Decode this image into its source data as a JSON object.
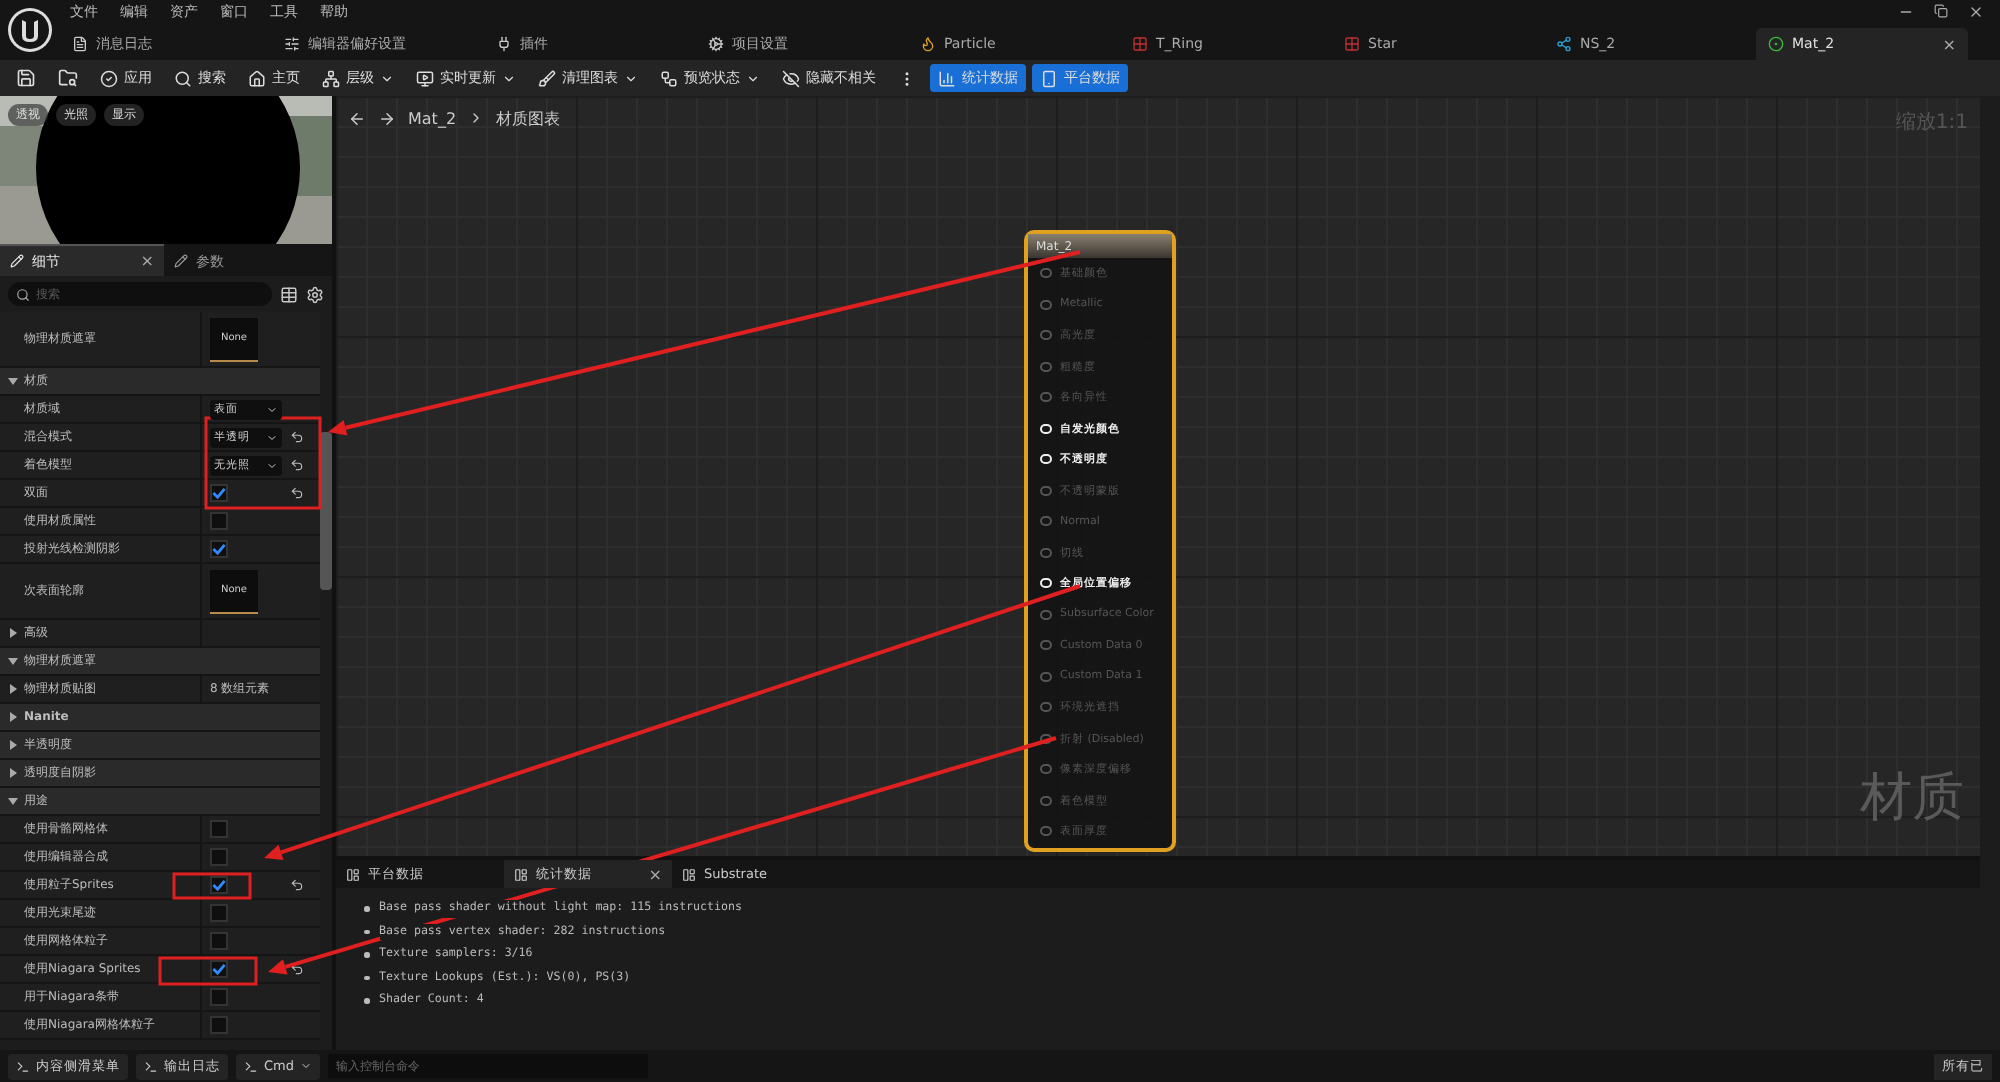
{
  "menu": [
    "文件",
    "编辑",
    "资产",
    "窗口",
    "工具",
    "帮助"
  ],
  "tabs": [
    {
      "label": "消息日志",
      "selected": false
    },
    {
      "label": "编辑器偏好设置",
      "selected": false
    },
    {
      "label": "插件",
      "selected": false
    },
    {
      "label": "项目设置",
      "selected": false
    },
    {
      "label": "Particle",
      "selected": false
    },
    {
      "label": "T_Ring",
      "selected": false
    },
    {
      "label": "Star",
      "selected": false
    },
    {
      "label": "NS_2",
      "selected": false
    },
    {
      "label": "Mat_2",
      "selected": true,
      "close": "×"
    }
  ],
  "toolbar": [
    {
      "kind": "icon"
    },
    {
      "kind": "icon"
    },
    {
      "label": "应用",
      "dropdown": false,
      "kind": "plain"
    },
    {
      "label": "搜索",
      "dropdown": false,
      "kind": "plain"
    },
    {
      "label": "主页",
      "dropdown": false,
      "kind": "plain"
    },
    {
      "label": "层级",
      "dropdown": true,
      "kind": "plain"
    },
    {
      "label": "实时更新",
      "dropdown": true,
      "kind": "plain"
    },
    {
      "label": "清理图表",
      "dropdown": true,
      "kind": "plain"
    },
    {
      "label": "预览状态",
      "dropdown": true,
      "kind": "plain"
    },
    {
      "label": "隐藏不相关",
      "dropdown": false,
      "kind": "plain"
    },
    {
      "kind": "more"
    },
    {
      "label": "统计数据",
      "kind": "primary"
    },
    {
      "label": "平台数据",
      "kind": "primary"
    }
  ],
  "preview": {
    "buttons": [
      "透视",
      "光照",
      "显示"
    ]
  },
  "details_tabs": [
    {
      "label": "细节",
      "selected": true,
      "close": "×"
    },
    {
      "label": "参数",
      "selected": false
    }
  ],
  "search": {
    "placeholder": "搜索"
  },
  "properties": [
    {
      "kind": "asset",
      "label": "物理材质遮罩",
      "value": "None",
      "modified": false
    },
    {
      "kind": "section",
      "label": "材质",
      "expanded": true
    },
    {
      "kind": "dropdown",
      "label": "材质域",
      "value": "表面",
      "modified": false
    },
    {
      "kind": "dropdown",
      "label": "混合模式",
      "value": "半透明",
      "modified": true
    },
    {
      "kind": "dropdown",
      "label": "着色模型",
      "value": "无光照",
      "modified": true
    },
    {
      "kind": "checkbox",
      "label": "双面",
      "checked": true,
      "modified": true
    },
    {
      "kind": "checkbox",
      "label": "使用材质属性",
      "checked": false,
      "modified": false
    },
    {
      "kind": "checkbox",
      "label": "投射光线检测阴影",
      "checked": true,
      "modified": false
    },
    {
      "kind": "asset",
      "label": "次表面轮廓",
      "value": "None",
      "modified": false
    },
    {
      "kind": "group",
      "label": "高级",
      "expanded": false
    },
    {
      "kind": "section",
      "label": "物理材质遮罩",
      "expanded": true
    },
    {
      "kind": "group",
      "label": "物理材质贴图",
      "value": "8 数组元素",
      "expanded": false
    },
    {
      "kind": "section",
      "label": "Nanite",
      "expanded": false
    },
    {
      "kind": "section",
      "label": "半透明度",
      "expanded": false
    },
    {
      "kind": "section",
      "label": "透明度自阴影",
      "expanded": false
    },
    {
      "kind": "section",
      "label": "用途",
      "expanded": true
    },
    {
      "kind": "checkbox",
      "label": "使用骨骼网格体",
      "checked": false,
      "modified": false
    },
    {
      "kind": "checkbox",
      "label": "使用编辑器合成",
      "checked": false,
      "modified": false
    },
    {
      "kind": "checkbox",
      "label": "使用粒子Sprites",
      "checked": true,
      "modified": true
    },
    {
      "kind": "checkbox",
      "label": "使用光束尾迹",
      "checked": false,
      "modified": false
    },
    {
      "kind": "checkbox",
      "label": "使用网格体粒子",
      "checked": false,
      "modified": false
    },
    {
      "kind": "checkbox",
      "label": "使用Niagara Sprites",
      "checked": true,
      "modified": true
    },
    {
      "kind": "checkbox",
      "label": "用于Niagara条带",
      "checked": false,
      "modified": false
    },
    {
      "kind": "checkbox",
      "label": "使用Niagara网格体粒子",
      "checked": false,
      "modified": false
    }
  ],
  "graph": {
    "breadcrumb": [
      "Mat_2",
      "材质图表"
    ],
    "zoom": "缩放1:1",
    "label": "材质",
    "node": {
      "title": "Mat_2",
      "pins": [
        {
          "label": "基础颜色",
          "active": false
        },
        {
          "label": "Metallic",
          "active": false
        },
        {
          "label": "高光度",
          "active": false
        },
        {
          "label": "粗糙度",
          "active": false
        },
        {
          "label": "各向异性",
          "active": false
        },
        {
          "label": "自发光颜色",
          "active": true
        },
        {
          "label": "不透明度",
          "active": true
        },
        {
          "label": "不透明蒙版",
          "active": false
        },
        {
          "label": "Normal",
          "active": false
        },
        {
          "label": "切线",
          "active": false
        },
        {
          "label": "全局位置偏移",
          "active": true
        },
        {
          "label": "Subsurface Color",
          "active": false
        },
        {
          "label": "Custom Data 0",
          "active": false
        },
        {
          "label": "Custom Data 1",
          "active": false
        },
        {
          "label": "环境光遮挡",
          "active": false
        },
        {
          "label": "折射 (Disabled)",
          "active": false
        },
        {
          "label": "像素深度偏移",
          "active": false
        },
        {
          "label": "着色模型",
          "active": false
        },
        {
          "label": "表面厚度",
          "active": false
        }
      ]
    }
  },
  "bottom": {
    "tabs": [
      {
        "label": "平台数据",
        "selected": false
      },
      {
        "label": "统计数据",
        "selected": true,
        "close": "×"
      },
      {
        "label": "Substrate",
        "selected": false
      }
    ],
    "stats": [
      "Base pass shader without light map: 115 instructions",
      "Base pass vertex shader: 282 instructions",
      "Texture samplers: 3/16",
      "Texture Lookups (Est.): VS(0), PS(3)",
      "Shader Count: 4"
    ]
  },
  "status": {
    "items": [
      "内容侧滑菜单",
      "输出日志"
    ],
    "cmd": "Cmd",
    "placeholder": "输入控制台命令",
    "right": "所有已"
  }
}
